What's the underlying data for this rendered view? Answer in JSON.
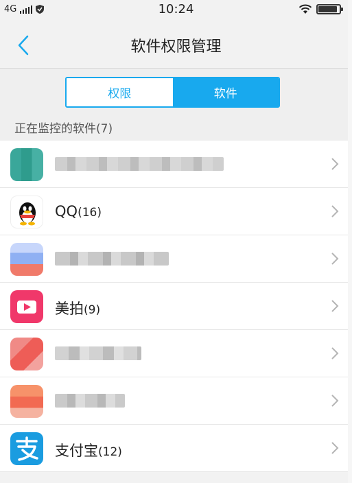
{
  "status_bar": {
    "network": "4G",
    "time": "10:24",
    "battery_level": 0.9
  },
  "nav": {
    "title": "软件权限管理"
  },
  "segment": {
    "tabs": [
      {
        "label": "权限",
        "selected": false
      },
      {
        "label": "软件",
        "selected": true
      }
    ]
  },
  "section": {
    "label": "正在监控的软件(7)"
  },
  "apps": [
    {
      "name": "",
      "count": "",
      "redacted": true
    },
    {
      "name": "QQ",
      "count": "(16)",
      "icon": "qq-penguin-icon"
    },
    {
      "name": "",
      "count": "",
      "redacted": true
    },
    {
      "name": "美拍",
      "count": "(9)",
      "icon": "meipai-play-icon"
    },
    {
      "name": "",
      "count": "",
      "redacted": true
    },
    {
      "name": "",
      "count": "",
      "redacted": true
    },
    {
      "name": "支付宝",
      "count": "(12)",
      "icon": "alipay-icon"
    }
  ],
  "colors": {
    "accent": "#18a9ee",
    "background": "#efefef",
    "qq_red": "#e8403a",
    "meipai_pink": "#f0386a",
    "alipay_blue": "#1a9ce0"
  }
}
